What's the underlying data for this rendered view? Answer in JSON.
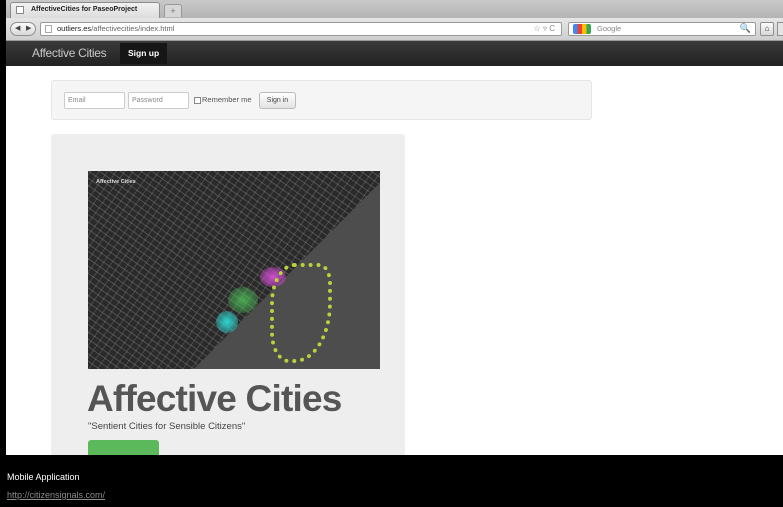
{
  "browser": {
    "tab_title": "AffectiveCities for PaseoProject",
    "new_tab_label": "+",
    "back_glyph": "◀",
    "forward_glyph": "▶",
    "url_host": "outliers.es",
    "url_path": "/affectivecities/index.html",
    "url_controls": "☆ ▿ C",
    "search_placeholder": "Google",
    "search_glyph": "🔍",
    "home_glyph": "⌂"
  },
  "site_nav": {
    "brand": "Affective Cities",
    "signup_label": "Sign up"
  },
  "login": {
    "email_placeholder": "Email",
    "password_placeholder": "Password",
    "remember_label": "Remember me",
    "signin_label": "Sign in"
  },
  "hero": {
    "map_label": "Affective Cities",
    "title": "Affective Cities",
    "subtitle": "\"Sentient Cities for Sensible Citizens\""
  },
  "caption": {
    "text": "Mobile Application",
    "link": "http://citizensignals.com/"
  },
  "colors": {
    "navbar": "#2b2b2b",
    "hero_button": "#5bb85b",
    "map_background": "#2a2a2a"
  }
}
